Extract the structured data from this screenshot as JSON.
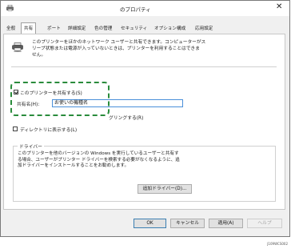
{
  "window": {
    "title": "のプロパティ",
    "close_glyph": "✕"
  },
  "tabs": [
    {
      "label": "全般"
    },
    {
      "label": "共有"
    },
    {
      "label": "ポート"
    },
    {
      "label": "詳細設定"
    },
    {
      "label": "色の管理"
    },
    {
      "label": "セキュリティ"
    },
    {
      "label": "オプション構成"
    },
    {
      "label": "応用設定"
    }
  ],
  "sharing": {
    "intro_line1": "このプリンターをほかのネットワーク ユーザーと共有できます。コンピューターがス",
    "intro_line2": "リープ状態または電源が入っていないときは、プリンターを利用することはできま",
    "intro_line3": "せん。",
    "share_checkbox_label": "このプリンターを共有する(S)",
    "share_checked": true,
    "share_name_label": "共有名(H):",
    "share_name_value": "お使いの機種名",
    "render_jobs_label": "グリングする(R)",
    "list_in_directory_label": "ディレクトリに表示する(L)",
    "list_in_directory_checked": false
  },
  "drivers": {
    "group_title": "ドライバー",
    "text_line1": "このプリンターを他のバージョンの Windows を実行しているユーザーと共有す",
    "text_line2": "る場合、ユーザーがプリンター ドライバーを検索する必要がなくなるように、追",
    "text_line3": "加ドライバーをインストールすることをお勧めします。",
    "additional_drivers_button": "追加ドライバー(D)..."
  },
  "footer": {
    "ok": "OK",
    "cancel": "キャンセル",
    "apply": "適用(A)",
    "help": "ヘルプ"
  },
  "caption": "J109WCS002",
  "colors": {
    "highlight": "#2a8c3c",
    "focus_border": "#4a90d9"
  }
}
